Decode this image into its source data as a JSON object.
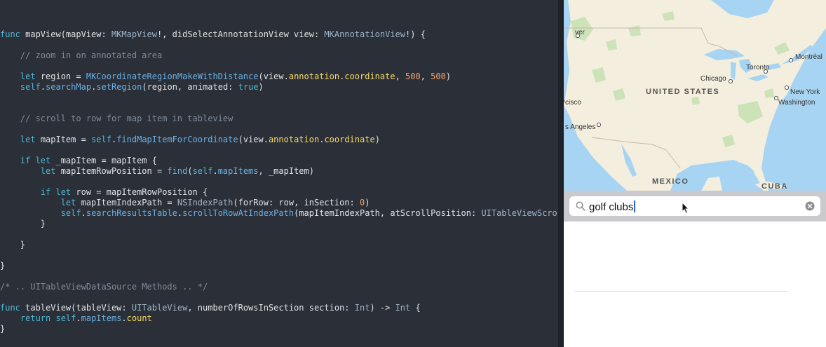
{
  "code": {
    "lines": [
      [
        [
          "func ",
          "kw"
        ],
        [
          "mapView",
          ""
        ],
        [
          "(mapView: ",
          ""
        ],
        [
          "MKMapView",
          "ty"
        ],
        [
          "!, didSelectAnnotationView view: ",
          ""
        ],
        [
          "MKAnnotationView",
          "ty"
        ],
        [
          "!) {",
          ""
        ]
      ],
      [],
      [
        [
          "    // zoom in on annotated area",
          "cm"
        ]
      ],
      [],
      [
        [
          "    ",
          ""
        ],
        [
          "let ",
          "kw"
        ],
        [
          "region = ",
          ""
        ],
        [
          "MKCoordinateRegionMakeWithDistance",
          "fn"
        ],
        [
          "(view.",
          ""
        ],
        [
          "annotation",
          "pr"
        ],
        [
          ".",
          ""
        ],
        [
          "coordinate",
          "pr"
        ],
        [
          ", ",
          ""
        ],
        [
          "500",
          "nm"
        ],
        [
          ", ",
          ""
        ],
        [
          "500",
          "nm"
        ],
        [
          ")",
          ""
        ]
      ],
      [
        [
          "    ",
          ""
        ],
        [
          "self",
          "kw"
        ],
        [
          ".",
          ""
        ],
        [
          "searchMap",
          "fn"
        ],
        [
          ".",
          ""
        ],
        [
          "setRegion",
          "fn"
        ],
        [
          "(region, animated: ",
          ""
        ],
        [
          "true",
          "kw"
        ],
        [
          ")",
          ""
        ]
      ],
      [],
      [],
      [
        [
          "    // scroll to row for map item in tableview",
          "cm"
        ]
      ],
      [],
      [
        [
          "    ",
          ""
        ],
        [
          "let ",
          "kw"
        ],
        [
          "mapItem = ",
          ""
        ],
        [
          "self",
          "kw"
        ],
        [
          ".",
          ""
        ],
        [
          "findMapItemForCoordinate",
          "fn"
        ],
        [
          "(view.",
          ""
        ],
        [
          "annotation",
          "pr"
        ],
        [
          ".",
          ""
        ],
        [
          "coordinate",
          "pr"
        ],
        [
          ")",
          ""
        ]
      ],
      [],
      [
        [
          "    ",
          ""
        ],
        [
          "if let ",
          "kw"
        ],
        [
          "_mapItem = mapItem {",
          ""
        ]
      ],
      [
        [
          "        ",
          ""
        ],
        [
          "let ",
          "kw"
        ],
        [
          "mapItemRowPosition = ",
          ""
        ],
        [
          "find",
          "fn"
        ],
        [
          "(",
          ""
        ],
        [
          "self",
          "kw"
        ],
        [
          ".",
          ""
        ],
        [
          "mapItems",
          "fn"
        ],
        [
          ", _mapItem)",
          ""
        ]
      ],
      [],
      [
        [
          "        ",
          ""
        ],
        [
          "if let ",
          "kw"
        ],
        [
          "row = mapItemRowPosition {",
          ""
        ]
      ],
      [
        [
          "            ",
          ""
        ],
        [
          "let ",
          "kw"
        ],
        [
          "mapItemIndexPath = ",
          ""
        ],
        [
          "NSIndexPath",
          "ty"
        ],
        [
          "(forRow: row, inSection: ",
          ""
        ],
        [
          "0",
          "nm"
        ],
        [
          ")",
          ""
        ]
      ],
      [
        [
          "            ",
          ""
        ],
        [
          "self",
          "kw"
        ],
        [
          ".",
          ""
        ],
        [
          "searchResultsTable",
          "fn"
        ],
        [
          ".",
          ""
        ],
        [
          "scrollToRowAtIndexPath",
          "fn"
        ],
        [
          "(mapItemIndexPath, atScrollPosition: ",
          ""
        ],
        [
          "UITableViewScrollPosition",
          "ty"
        ]
      ],
      [
        [
          "        }",
          ""
        ]
      ],
      [],
      [
        [
          "    }",
          ""
        ]
      ],
      [],
      [
        [
          "}",
          ""
        ]
      ],
      [],
      [
        [
          "/* .. UITableViewDataSource Methods .. */",
          "cm"
        ]
      ],
      [],
      [
        [
          "func ",
          "kw"
        ],
        [
          "tableView",
          ""
        ],
        [
          "(tableView: ",
          ""
        ],
        [
          "UITableView",
          "ty"
        ],
        [
          ", numberOfRowsInSection section: ",
          ""
        ],
        [
          "Int",
          "ty"
        ],
        [
          ") -> ",
          ""
        ],
        [
          "Int",
          "ty"
        ],
        [
          " {",
          ""
        ]
      ],
      [
        [
          "    ",
          ""
        ],
        [
          "return ",
          "kw"
        ],
        [
          "self",
          "kw"
        ],
        [
          ".",
          ""
        ],
        [
          "mapItems",
          "fn"
        ],
        [
          ".",
          ""
        ],
        [
          "count",
          "pr"
        ]
      ],
      [
        [
          "}",
          ""
        ]
      ]
    ]
  },
  "map": {
    "labels": {
      "vancouver": "ver",
      "montreal": "Montréal",
      "toronto": "Toronto",
      "chicago": "Chicago",
      "new_york": "New York",
      "washington": "Washington",
      "san_francisco": "cisco",
      "los_angeles": "s Angeles",
      "united_states": "UNITED STATES",
      "mexico": "MEXICO",
      "cuba": "CUBA"
    }
  },
  "search": {
    "value": "golf clubs"
  },
  "colors": {
    "editor_bg": "#2b3038",
    "water": "#a7d4f2",
    "land": "#f3eede",
    "park": "#cbe3b6",
    "search_bar_bg": "#c9c9ce",
    "caret": "#2966d4"
  }
}
